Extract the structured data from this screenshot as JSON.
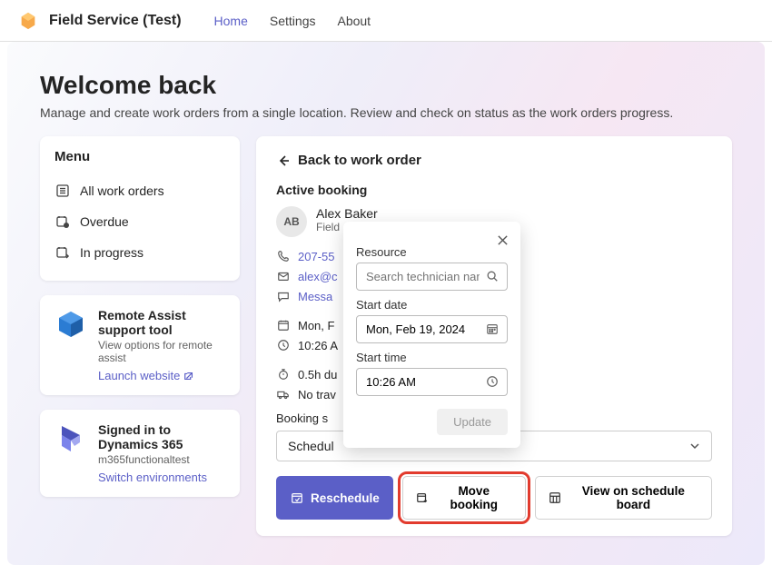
{
  "header": {
    "title": "Field Service (Test)",
    "nav": [
      {
        "label": "Home",
        "active": true
      },
      {
        "label": "Settings",
        "active": false
      },
      {
        "label": "About",
        "active": false
      }
    ]
  },
  "welcome": {
    "title": "Welcome back",
    "subtitle": "Manage and create work orders from a single location. Review and check on status as the work orders progress."
  },
  "menu": {
    "title": "Menu",
    "items": [
      {
        "label": "All work orders",
        "icon": "list"
      },
      {
        "label": "Overdue",
        "icon": "overdue"
      },
      {
        "label": "In progress",
        "icon": "progress"
      }
    ]
  },
  "remote_assist": {
    "title": "Remote Assist support tool",
    "subtitle": "View options for remote assist",
    "link_label": "Launch website"
  },
  "signed_in": {
    "title": "Signed in to Dynamics 365",
    "subtitle": "m365functionaltest",
    "link_label": "Switch environments"
  },
  "detail": {
    "back_label": "Back to work order",
    "section_title": "Active booking",
    "resource": {
      "initials": "AB",
      "name": "Alex Baker",
      "role": "Field"
    },
    "phone": "207-55",
    "email": "alex@c",
    "message_label": "Messa",
    "date_line": "Mon, F",
    "time_line": "10:26 A",
    "duration_line": "0.5h du",
    "travel_line": "No trav",
    "booking_status_label": "Booking s",
    "status_value": "Schedul",
    "actions": {
      "reschedule": "Reschedule",
      "move_booking": "Move booking",
      "view_on_board": "View on schedule board"
    }
  },
  "popover": {
    "resource_label": "Resource",
    "resource_placeholder": "Search technician name",
    "start_date_label": "Start date",
    "start_date_value": "Mon, Feb 19, 2024",
    "start_time_label": "Start time",
    "start_time_value": "10:26 AM",
    "update_label": "Update"
  }
}
